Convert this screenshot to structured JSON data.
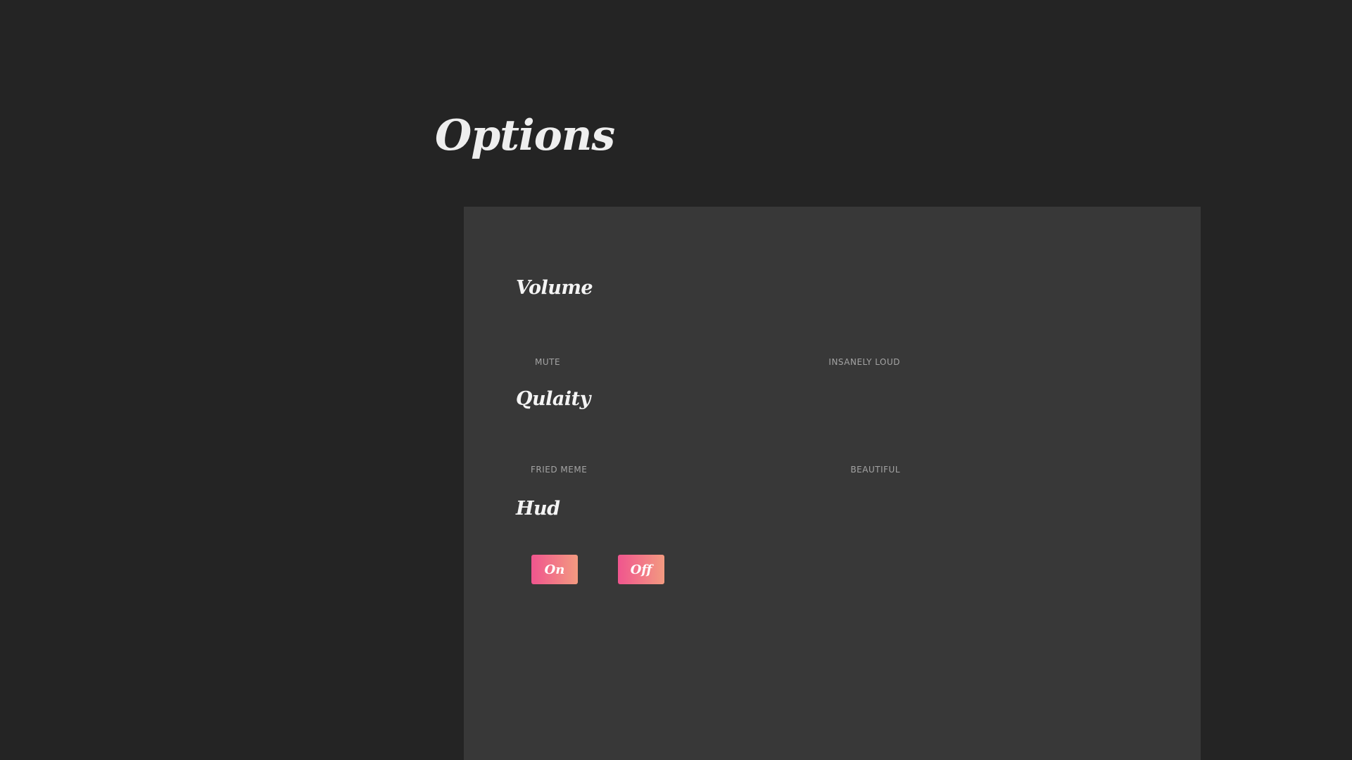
{
  "page": {
    "title": "Options"
  },
  "volume": {
    "heading": "Volume",
    "min_label": "Mute",
    "max_label": "Insanely Loud"
  },
  "quality": {
    "heading": "Qulaity",
    "min_label": "Fried Meme",
    "max_label": "Beautiful"
  },
  "hud": {
    "heading": "Hud",
    "on_label": "On",
    "off_label": "Off"
  },
  "colors": {
    "background": "#242424",
    "panel": "#383838",
    "button_gradient_start": "#f0558e",
    "button_gradient_end": "#f39a80"
  }
}
